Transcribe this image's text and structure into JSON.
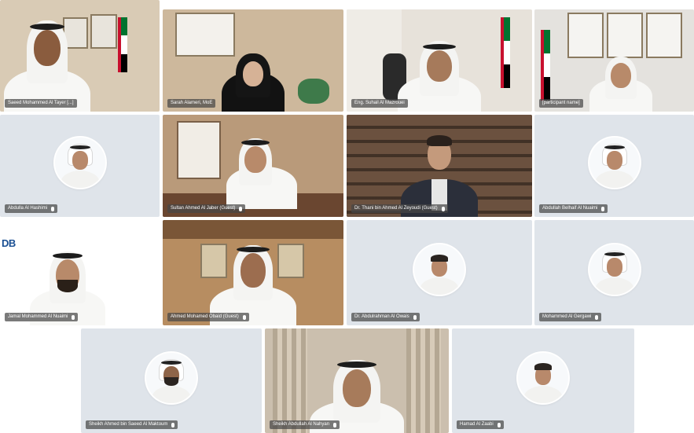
{
  "participants": [
    {
      "name": "Saeed Mohammed Al Tayer [...]",
      "type": "video"
    },
    {
      "name": "Sarah Alameri, MoE",
      "type": "video"
    },
    {
      "name": "Eng. Suhail Al Mazrouei",
      "type": "video"
    },
    {
      "name": "[participant name]",
      "type": "video"
    },
    {
      "name": "Abdulla Al Hashimi",
      "type": "avatar"
    },
    {
      "name": "Sultan Ahmed Al Jaber (Guest)",
      "type": "video"
    },
    {
      "name": "Dr. Thani bin Ahmed Al Zeyoudi (Guest)",
      "type": "video"
    },
    {
      "name": "Abdullah Belhaif Al Nuaimi",
      "type": "avatar"
    },
    {
      "name": "Jamal Mohammed Al Nuaimi",
      "type": "video"
    },
    {
      "name": "Ahmed Mohamed Obaid (Guest)",
      "type": "video"
    },
    {
      "name": "Dr. Abdulrahman Al Owais",
      "type": "avatar"
    },
    {
      "name": "Mohammed Al Gergawi",
      "type": "avatar"
    },
    {
      "name": "Sheikh Ahmed bin Saeed Al Maktoum",
      "type": "avatar"
    },
    {
      "name": "Sheikh Abdullah Al Nahyan",
      "type": "video"
    },
    {
      "name": "Hamad Al Zaabi",
      "type": "avatar"
    }
  ],
  "logos": {
    "dbl": "DB"
  },
  "icons": {
    "mic": "mic-icon"
  },
  "colors": {
    "nameplate_bg": "#464646",
    "avatar_tile_bg": "#dfe4ea"
  }
}
